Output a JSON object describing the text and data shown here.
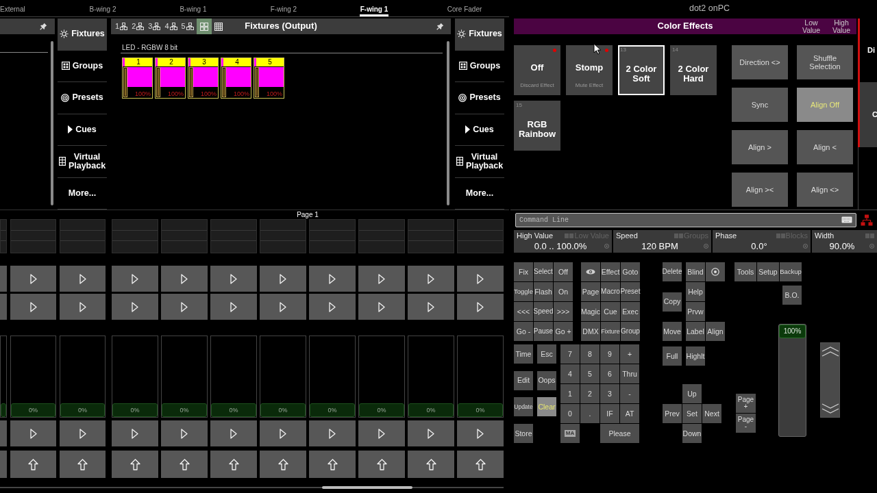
{
  "wing_tabs": [
    {
      "label": "External",
      "selected": false
    },
    {
      "label": "B-wing 2",
      "selected": false
    },
    {
      "label": "B-wing 1",
      "selected": false
    },
    {
      "label": "F-wing 2",
      "selected": false
    },
    {
      "label": "F-wing 1",
      "selected": true
    },
    {
      "label": "Core Fader",
      "selected": false
    }
  ],
  "view_bar_left": [
    {
      "label": "Fixtures",
      "selected": true
    },
    {
      "label": "Groups",
      "selected": false
    },
    {
      "label": "Presets",
      "selected": false
    },
    {
      "label": "Cues",
      "selected": false
    },
    {
      "label": "Virtual Playback",
      "selected": false
    },
    {
      "label": "More...",
      "selected": false
    }
  ],
  "fixture_window": {
    "view_buttons": [
      {
        "label": "1",
        "selected": false
      },
      {
        "label": "2",
        "selected": false
      },
      {
        "label": "3",
        "selected": false
      },
      {
        "label": "4",
        "selected": false
      },
      {
        "label": "5",
        "selected": false
      },
      {
        "selected": true
      },
      {
        "selected": false
      }
    ],
    "title": "Fixtures (Output)",
    "group_label": "LED - RGBW 8 bit",
    "fixtures": [
      {
        "number": "1",
        "reading": "100%",
        "level": 1
      },
      {
        "number": "2",
        "reading": "100%",
        "level": 1
      },
      {
        "number": "3",
        "reading": "100%",
        "level": 1
      },
      {
        "number": "4",
        "reading": "100%",
        "level": 1
      },
      {
        "number": "5",
        "reading": "100%",
        "level": 1
      }
    ]
  },
  "view_bar_right": [
    {
      "label": "Fixtures",
      "selected": true
    },
    {
      "label": "Groups",
      "selected": false
    },
    {
      "label": "Presets",
      "selected": false
    },
    {
      "label": "Cues",
      "selected": false
    },
    {
      "label": "Virtual Playback",
      "selected": false
    },
    {
      "label": "More...",
      "selected": false
    }
  ],
  "page_label": "Page 1",
  "executors": [
    {
      "reading": "0%",
      "level": 0
    },
    {
      "reading": "0%",
      "level": 0
    },
    {
      "reading": "0%",
      "level": 0
    },
    {
      "reading": "0%",
      "level": 0
    },
    {
      "reading": "0%",
      "level": 0
    },
    {
      "reading": "0%",
      "level": 0
    },
    {
      "reading": "0%",
      "level": 0
    },
    {
      "reading": "0%",
      "level": 0
    },
    {
      "reading": "0%",
      "level": 0
    },
    {
      "reading": "0%",
      "level": 0
    }
  ],
  "app_title": "dot2 onPC",
  "color_effects": {
    "title": "Color Effects",
    "header_labels": [
      "Low Value",
      "High Value"
    ],
    "effects": [
      {
        "label": "Off",
        "sublabel": "Discard Effect",
        "selected": false,
        "flagged": true
      },
      {
        "label": "Stomp",
        "sublabel": "Mute Effect",
        "selected": false,
        "flagged": true
      },
      {
        "number": "13",
        "label": "2 Color Soft",
        "selected": true,
        "flagged": false
      },
      {
        "number": "14",
        "label": "2 Color Hard",
        "selected": false,
        "flagged": false
      },
      {
        "number": "15",
        "label": "RGB Rainbow",
        "selected": false,
        "flagged": false
      }
    ],
    "options": [
      {
        "label": "Direction <>",
        "selected": false
      },
      {
        "label": "Shuffle Selection",
        "selected": false
      },
      {
        "label": "Sync",
        "selected": false
      },
      {
        "label": "Align Off",
        "selected": true
      },
      {
        "label": "Align >",
        "selected": false
      },
      {
        "label": "Align <",
        "selected": false
      },
      {
        "label": "Align ><",
        "selected": false
      },
      {
        "label": "Align <>",
        "selected": false
      }
    ]
  },
  "side_panel": [
    "Di",
    "C"
  ],
  "command_line": {
    "placeholder": "Command Line"
  },
  "encoders": [
    {
      "label": "High Value",
      "alt_label": "Low Value",
      "value": "0.0 .. 100.0%"
    },
    {
      "label": "Speed",
      "alt_label": "Groups",
      "value": "120 BPM"
    },
    {
      "label": "Phase",
      "alt_label": "Blocks",
      "value": "0.0°"
    },
    {
      "label": "Width",
      "value": "90.0%"
    }
  ],
  "keypad": {
    "command_keys": [
      {
        "label": "Fix",
        "active": false
      },
      {
        "label": "Select",
        "active": false
      },
      {
        "label": "Off",
        "active": false
      },
      {
        "label": "Toggle",
        "active": false
      },
      {
        "label": "Flash",
        "active": false
      },
      {
        "label": "On",
        "active": false
      },
      {
        "label": "<<<",
        "active": false
      },
      {
        "label": "Speed",
        "active": false
      },
      {
        "label": ">>>",
        "active": false
      },
      {
        "label": "Go -",
        "active": false
      },
      {
        "label": "Pause",
        "active": false
      },
      {
        "label": "Go +",
        "active": false
      }
    ],
    "function_keys": [
      {
        "kind": "icon",
        "active": false
      },
      {
        "kind": "text",
        "label": "Effect",
        "active": false
      },
      {
        "kind": "text",
        "label": "Goto",
        "active": false
      },
      {
        "kind": "text",
        "label": "Page",
        "active": false
      },
      {
        "kind": "text",
        "label": "Macro",
        "active": false
      },
      {
        "kind": "text",
        "label": "Preset",
        "active": false
      },
      {
        "kind": "text",
        "label": "Magic",
        "active": false
      },
      {
        "kind": "text",
        "label": "Cue",
        "active": false
      },
      {
        "kind": "text",
        "label": "Exec",
        "active": false
      },
      {
        "kind": "text",
        "label": "DMX",
        "active": false
      },
      {
        "kind": "text",
        "label": "Fixture",
        "active": false
      },
      {
        "kind": "text",
        "label": "Group",
        "active": false
      }
    ],
    "edit_keys": [
      {
        "label": "Time",
        "active": false
      },
      {
        "label": "Esc",
        "active": false
      },
      {
        "label": "Edit",
        "active": false
      },
      {
        "label": "Oops",
        "active": false
      },
      {
        "label": "Update",
        "active": false
      },
      {
        "label": "Clear",
        "active": true
      },
      {
        "label": "Store",
        "active": false
      }
    ],
    "number_keys": [
      {
        "kind": "text",
        "label": "7",
        "active": false
      },
      {
        "kind": "text",
        "label": "8",
        "active": false
      },
      {
        "kind": "text",
        "label": "9",
        "active": false
      },
      {
        "kind": "text",
        "label": "+",
        "active": false
      },
      {
        "kind": "text",
        "label": "4",
        "active": false
      },
      {
        "kind": "text",
        "label": "5",
        "active": false
      },
      {
        "kind": "text",
        "label": "6",
        "active": false
      },
      {
        "kind": "text",
        "label": "Thru",
        "active": false
      },
      {
        "kind": "text",
        "label": "1",
        "active": false
      },
      {
        "kind": "text",
        "label": "2",
        "active": false
      },
      {
        "kind": "text",
        "label": "3",
        "active": false
      },
      {
        "kind": "text",
        "label": "-",
        "active": false
      },
      {
        "kind": "text",
        "label": "0",
        "active": false
      },
      {
        "kind": "text",
        "label": ".",
        "active": false
      },
      {
        "kind": "text",
        "label": "IF",
        "active": false
      },
      {
        "kind": "text",
        "label": "AT",
        "active": false
      },
      {
        "kind": "badge",
        "label": "MA",
        "active": false
      },
      {
        "kind": "text",
        "label": "Please",
        "active": false
      }
    ],
    "object_keys": [
      {
        "kind": "text",
        "label": "Delete",
        "active": false
      },
      {
        "kind": "text",
        "label": "Blind",
        "active": false
      },
      {
        "kind": "icon",
        "active": false
      },
      {
        "kind": "text",
        "label": "Help",
        "active": false
      },
      {
        "kind": "text",
        "label": "Copy",
        "active": false
      },
      {
        "kind": "text",
        "label": "Prvw",
        "active": false
      },
      {
        "kind": "text",
        "label": "Move",
        "active": false
      },
      {
        "kind": "text",
        "label": "Label",
        "active": false
      },
      {
        "kind": "text",
        "label": "Align",
        "active": false
      },
      {
        "kind": "text",
        "label": "Full",
        "active": false
      },
      {
        "kind": "text",
        "label": "Highlt",
        "active": false
      }
    ],
    "navigation_keys": [
      {
        "label": "Up",
        "active": false
      },
      {
        "label": "Prev",
        "active": false
      },
      {
        "label": "Set",
        "active": false
      },
      {
        "label": "Next",
        "active": false
      },
      {
        "label": "Down",
        "active": false
      }
    ],
    "system_keys": [
      {
        "label": "Tools",
        "active": false
      },
      {
        "label": "Setup",
        "active": false
      },
      {
        "label": "Backup",
        "active": false
      },
      {
        "label": "B.O.",
        "active": false
      }
    ],
    "page_keys": [
      {
        "label": "Page +",
        "active": false
      },
      {
        "label": "Page -",
        "active": false
      }
    ]
  },
  "master_fader": {
    "reading": "100%",
    "level": 1
  }
}
